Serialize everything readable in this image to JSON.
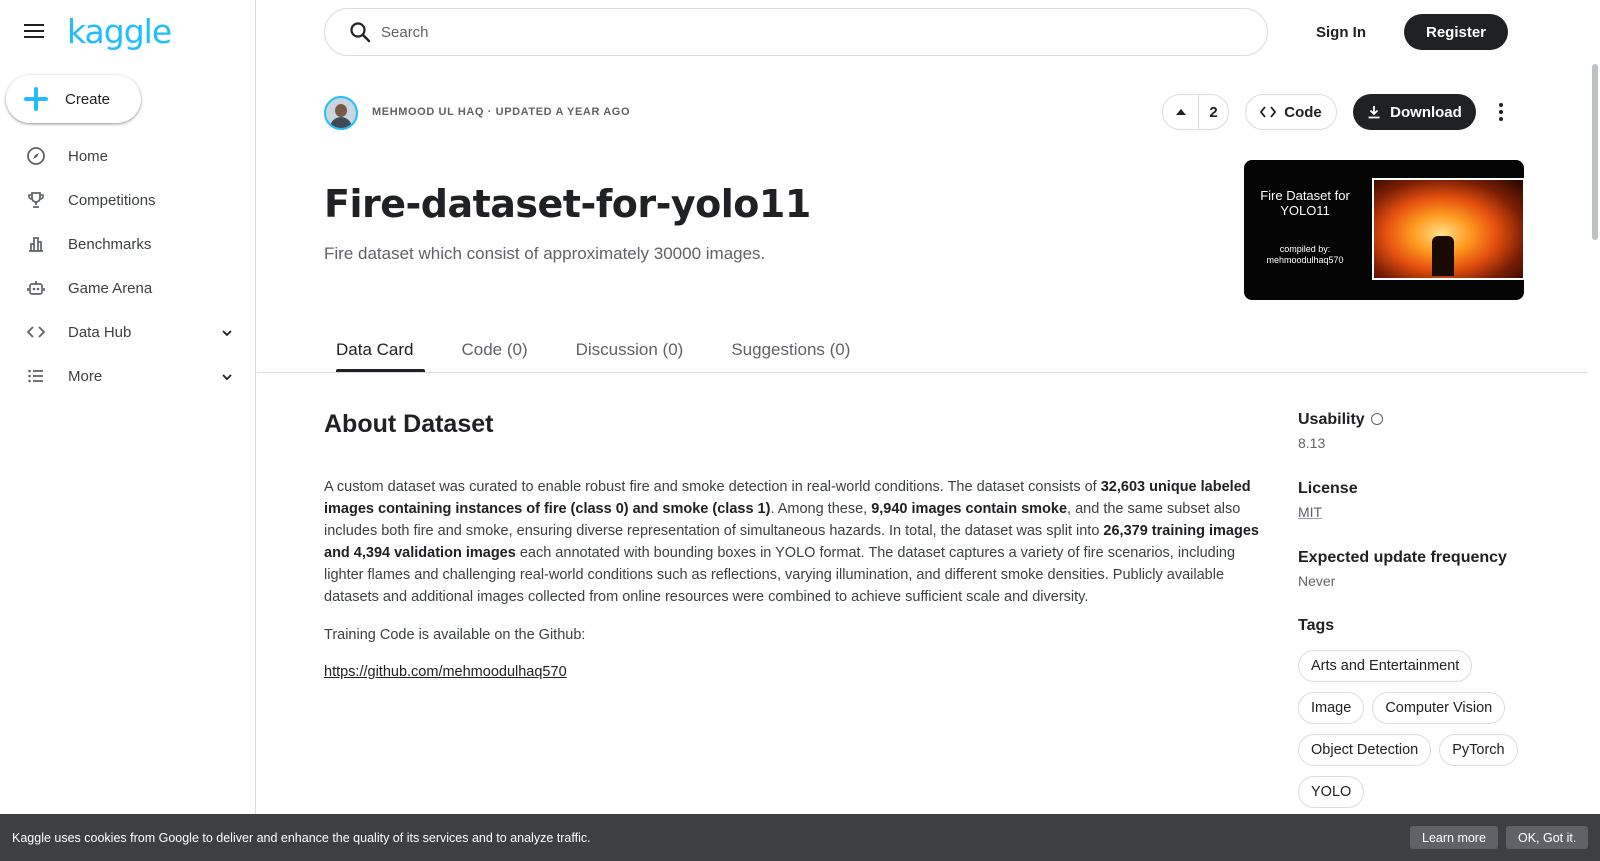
{
  "brand": {
    "logo_text": "kaggle",
    "accent": "#20beff"
  },
  "sidebar": {
    "create_label": "Create",
    "items": [
      {
        "label": "Home",
        "icon": "compass-icon"
      },
      {
        "label": "Competitions",
        "icon": "trophy-icon"
      },
      {
        "label": "Benchmarks",
        "icon": "bar-chart-icon"
      },
      {
        "label": "Game Arena",
        "icon": "robot-icon"
      },
      {
        "label": "Data Hub",
        "icon": "code-brackets-icon",
        "expandable": true
      },
      {
        "label": "More",
        "icon": "list-icon",
        "expandable": true
      }
    ]
  },
  "header": {
    "search_placeholder": "Search",
    "signin_label": "Sign In",
    "register_label": "Register"
  },
  "dataset": {
    "byline": "MEHMOOD UL HAQ · UPDATED A YEAR AGO",
    "upvotes": "2",
    "code_label": "Code",
    "download_label": "Download",
    "title": "Fire-dataset-for-yolo11",
    "subtitle": "Fire dataset which consist of approximately 30000 images.",
    "cover": {
      "title": "Fire Dataset for YOLO11",
      "compiled_by": "compiled by: mehmoodulhaq570"
    }
  },
  "tabs": [
    {
      "label": "Data Card",
      "active": true
    },
    {
      "label": "Code (0)",
      "active": false
    },
    {
      "label": "Discussion (0)",
      "active": false
    },
    {
      "label": "Suggestions (0)",
      "active": false
    }
  ],
  "about": {
    "heading": "About Dataset",
    "p1_a": "A custom dataset was curated to enable robust fire and smoke detection in real-world conditions. The dataset consists of ",
    "p1_b": "32,603 unique labeled images containing instances of fire (class 0) and smoke (class 1)",
    "p1_c": ". Among these, ",
    "p1_d": "9,940 images contain smoke",
    "p1_e": ", and the same subset also includes both fire and smoke, ensuring diverse representation of simultaneous hazards. In total, the dataset was split into ",
    "p1_f": "26,379 training images and 4,394 validation images",
    "p1_g": " each annotated with bounding boxes in YOLO format. The dataset captures a variety of fire scenarios, including lighter flames and challenging real-world conditions such as reflections, varying illumination, and different smoke densities. Publicly available datasets and additional images collected from online resources were combined to achieve sufficient scale and diversity.",
    "training_text": "Training Code is available on the Github:",
    "github_link": "https://github.com/mehmoodulhaq570"
  },
  "meta": {
    "usability_label": "Usability",
    "usability_value": "8.13",
    "license_label": "License",
    "license_value": "MIT",
    "frequency_label": "Expected update frequency",
    "frequency_value": "Never",
    "tags_label": "Tags",
    "tags": [
      "Arts and Entertainment",
      "Image",
      "Computer Vision",
      "Object Detection",
      "PyTorch",
      "YOLO"
    ]
  },
  "cookie": {
    "text": "Kaggle uses cookies from Google to deliver and enhance the quality of its services and to analyze traffic.",
    "learn_more": "Learn more",
    "ok": "OK, Got it."
  }
}
